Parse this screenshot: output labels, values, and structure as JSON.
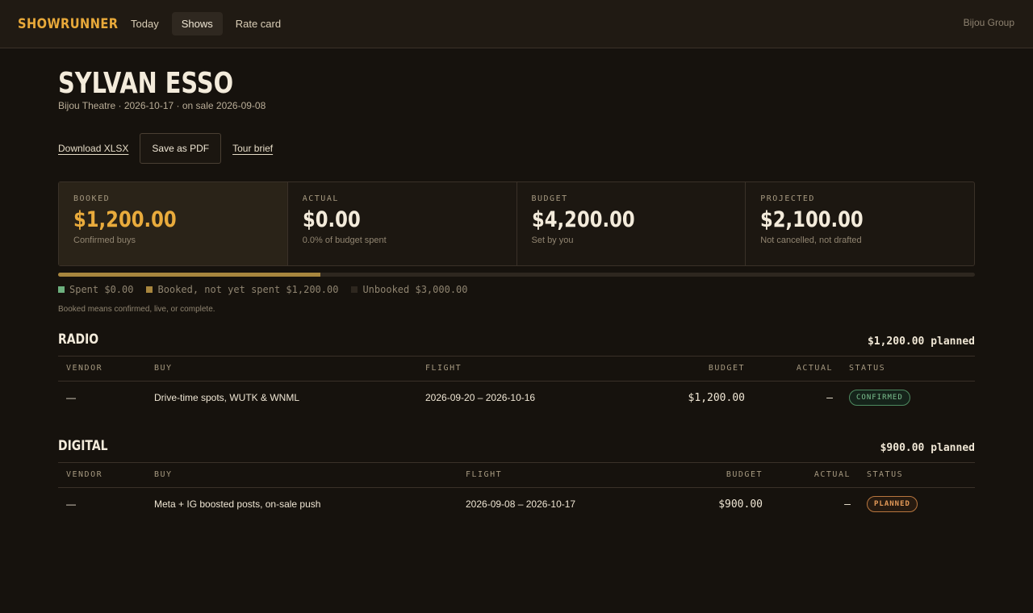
{
  "app": {
    "logo": "SHOWRUNNER",
    "nav": [
      {
        "label": "Today"
      },
      {
        "label": "Shows",
        "active": true
      },
      {
        "label": "Rate card"
      }
    ],
    "org": "Bijou Group"
  },
  "show": {
    "title": "SYLVAN ESSO",
    "subtitle": "Bijou Theatre · 2026-10-17 · on sale 2026-09-08"
  },
  "actions": {
    "download_xlsx": "Download XLSX",
    "save_pdf": "Save as PDF",
    "tour_brief": "Tour brief"
  },
  "stats": [
    {
      "label": "BOOKED",
      "value": "$1,200.00",
      "sub": "Confirmed buys"
    },
    {
      "label": "ACTUAL",
      "value": "$0.00",
      "sub": "0.0% of budget spent"
    },
    {
      "label": "BUDGET",
      "value": "$4,200.00",
      "sub": "Set by you"
    },
    {
      "label": "PROJECTED",
      "value": "$2,100.00",
      "sub": "Not cancelled, not drafted"
    }
  ],
  "progress": {
    "booked_fraction": 0.2857,
    "spent_fraction": 0.0
  },
  "legend": [
    {
      "label": "Spent $0.00",
      "color": "#6db07e"
    },
    {
      "label": "Booked, not yet spent $1,200.00",
      "color": "#a8863e"
    },
    {
      "label": "Unbooked $3,000.00",
      "color": "#2e271f"
    }
  ],
  "note": "Booked means confirmed, live, or complete.",
  "sections": [
    {
      "title": "RADIO",
      "planned": "$1,200.00 planned",
      "columns": [
        "VENDOR",
        "BUY",
        "FLIGHT",
        "BUDGET",
        "ACTUAL",
        "STATUS"
      ],
      "rows": [
        {
          "vendor": "—",
          "buy": "Drive-time spots, WUTK & WNML",
          "flight": "2026-09-20 – 2026-10-16",
          "budget": "$1,200.00",
          "actual": "—",
          "status": "CONFIRMED"
        }
      ]
    },
    {
      "title": "DIGITAL",
      "planned": "$900.00 planned",
      "columns": [
        "VENDOR",
        "BUY",
        "FLIGHT",
        "BUDGET",
        "ACTUAL",
        "STATUS"
      ],
      "rows": [
        {
          "vendor": "—",
          "buy": "Meta + IG boosted posts, on-sale push",
          "flight": "2026-09-08 – 2026-10-17",
          "budget": "$900.00",
          "actual": "—",
          "status": "PLANNED"
        }
      ]
    }
  ],
  "colors": {
    "accent": "#e9ab3c",
    "confirmed": "#7cc08f",
    "planned": "#e59a58"
  }
}
